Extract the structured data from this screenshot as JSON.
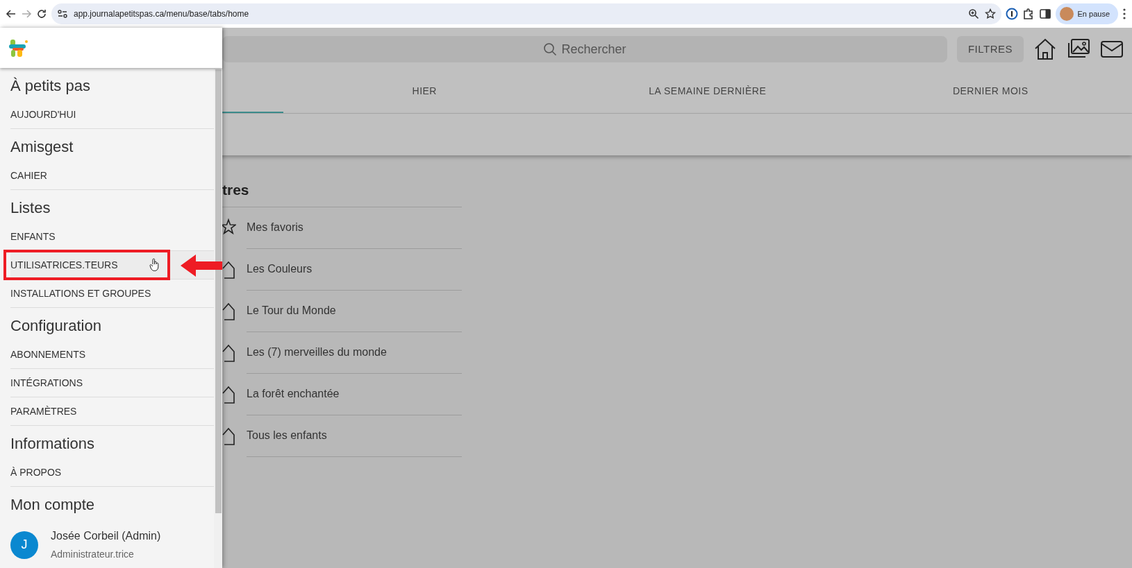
{
  "browser": {
    "url": "app.journalapetitspas.ca/menu/base/tabs/home",
    "profile_label": "En pause"
  },
  "toolbar": {
    "search_placeholder": "Rechercher",
    "filter_button": "FILTRES"
  },
  "tabs": [
    {
      "selected": true
    },
    {
      "label": "HIER",
      "selected": false
    },
    {
      "label": "LA SEMAINE DERNIÈRE",
      "selected": false
    },
    {
      "label": "DERNIER MOIS",
      "selected": false
    }
  ],
  "groups": {
    "heading": "tres",
    "items": [
      {
        "label": "Mes favoris",
        "kind": "star"
      },
      {
        "label": "Les Couleurs",
        "kind": "house"
      },
      {
        "label": "Le Tour du Monde",
        "kind": "house"
      },
      {
        "label": "Les (7) merveilles du monde",
        "kind": "house"
      },
      {
        "label": "La forêt enchantée",
        "kind": "house"
      },
      {
        "label": "Tous les enfants",
        "kind": "house"
      }
    ]
  },
  "drawer": {
    "sections": [
      {
        "title": "À petits pas",
        "items": [
          {
            "label": "AUJOURD'HUI",
            "highlighted": false
          }
        ]
      },
      {
        "title": "Amisgest",
        "items": [
          {
            "label": "CAHIER",
            "highlighted": false
          }
        ]
      },
      {
        "title": "Listes",
        "items": [
          {
            "label": "ENFANTS",
            "highlighted": false
          },
          {
            "label": "UTILISATRICES.TEURS",
            "highlighted": true
          },
          {
            "label": "INSTALLATIONS ET GROUPES",
            "highlighted": false
          }
        ]
      },
      {
        "title": "Configuration",
        "items": [
          {
            "label": "ABONNEMENTS",
            "highlighted": false
          },
          {
            "label": "INTÉGRATIONS",
            "highlighted": false
          },
          {
            "label": "PARAMÈTRES",
            "highlighted": false
          }
        ]
      },
      {
        "title": "Informations",
        "items": [
          {
            "label": "À PROPOS",
            "highlighted": false
          }
        ]
      },
      {
        "title": "Mon compte"
      }
    ],
    "account": {
      "initial": "J",
      "name": "Josée Corbeil (Admin)",
      "role": "Administrateur.trice"
    }
  }
}
